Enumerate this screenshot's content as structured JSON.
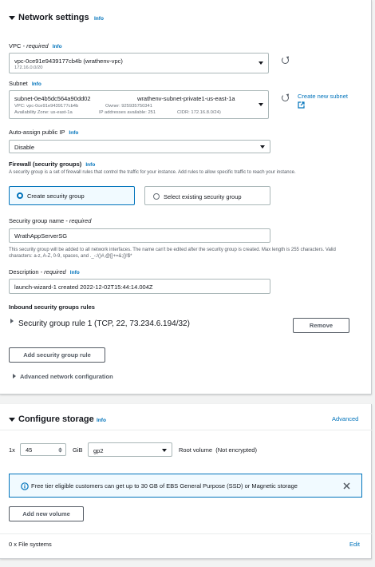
{
  "network": {
    "title": "Network settings",
    "info": "Info",
    "vpc": {
      "label": "VPC",
      "required": " - required",
      "info": "Info",
      "value": "vpc-0ce91e9439177cb4b (wrathenv-vpc)",
      "cidr": "172.16.0.0/20"
    },
    "subnet": {
      "label": "Subnet",
      "info": "Info",
      "id": "subnet-0e4b5dc564a90dd02",
      "name": "wrathenv-subnet-private1-us-east-1a",
      "vpc_line": "VPC: vpc-0ce91e9439177cb4b",
      "owner": "Owner: 925935750341",
      "az": "Availability Zone: us-east-1a",
      "ips": "IP addresses available: 251",
      "cidr": "CIDR: 172.16.8.0/24)",
      "create_link": "Create new subnet"
    },
    "auto_assign": {
      "label": "Auto-assign public IP",
      "info": "Info",
      "value": "Disable"
    },
    "firewall": {
      "label": "Firewall (security groups)",
      "info": "Info",
      "description": "A security group is a set of firewall rules that control the traffic for your instance. Add rules to allow specific traffic to reach your instance.",
      "create_option": "Create security group",
      "existing_option": "Select existing security group"
    },
    "sg_name": {
      "label": "Security group name",
      "required": " - required",
      "value": "WrathAppServerSG",
      "description": "This security group will be added to all network interfaces. The name can't be edited after the security group is created. Max length is 255 characters. Valid characters: a-z, A-Z, 0-9, spaces, and ._-:/()#,@[]+=&;{}!$*"
    },
    "description": {
      "label": "Description",
      "required": " - required",
      "info": "Info",
      "value": "launch-wizard-1 created 2022-12-02T15:44:14.004Z"
    },
    "inbound": {
      "title": "Inbound security groups rules",
      "rule": "Security group rule 1 (TCP, 22, 73.234.6.194/32)",
      "remove": "Remove",
      "add_rule": "Add security group rule"
    },
    "advanced": "Advanced network configuration"
  },
  "storage": {
    "title": "Configure storage",
    "info": "Info",
    "advanced": "Advanced",
    "multiplier": "1x",
    "size": "45",
    "unit": "GiB",
    "volume_type": "gp2",
    "root_label": "Root volume  (Not encrypted)",
    "notice": "Free tier eligible customers can get up to 30 GB of EBS General Purpose (SSD) or Magnetic storage",
    "add_volume": "Add new volume",
    "file_systems": "0 x File systems",
    "edit": "Edit"
  },
  "colors": {
    "link": "#0073bb",
    "notice_bg": "#f1faff",
    "notice_border": "#0073bb",
    "selected_option_bg": "#f1faff"
  }
}
